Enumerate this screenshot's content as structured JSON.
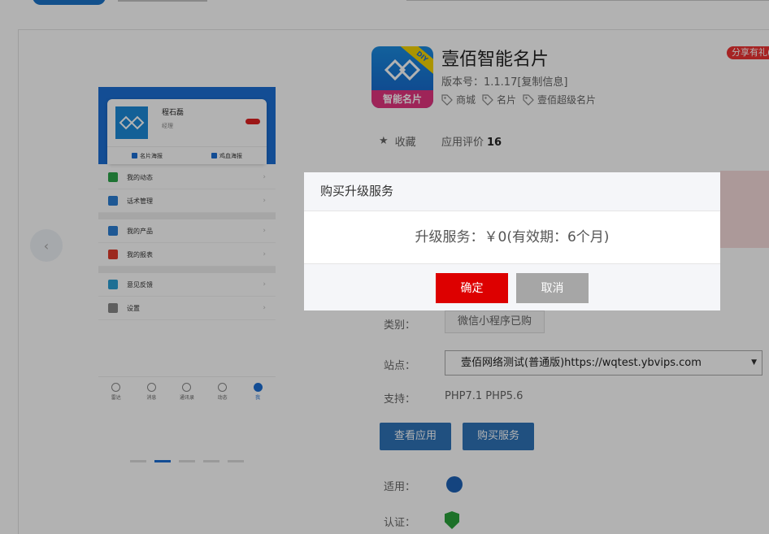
{
  "phone_preview": {
    "profile_name": "程石磊",
    "profile_role": "经理",
    "actions": [
      "名片海报",
      "鸡血海报"
    ],
    "menu_groups": [
      [
        {
          "label": "我的动态",
          "color": "#2ca54a"
        },
        {
          "label": "话术管理",
          "color": "#2c7fd4"
        }
      ],
      [
        {
          "label": "我的产品",
          "color": "#2c7fd4"
        },
        {
          "label": "我的报表",
          "color": "#e03b2c"
        }
      ],
      [
        {
          "label": "意见反馈",
          "color": "#2c9fd4"
        },
        {
          "label": "设置",
          "color": "#888888"
        }
      ]
    ],
    "tabs": [
      "雷达",
      "消息",
      "通讯录",
      "动态",
      "我"
    ]
  },
  "app": {
    "icon_label": "智能名片",
    "icon_diy": "DIY",
    "title": "壹佰智能名片",
    "version": "版本号：1.1.17[复制信息]",
    "tags": [
      "商城",
      "名片",
      "壹佰超级名片"
    ],
    "share_badge": "分享有礼(",
    "favorite": "收藏",
    "rating_label": "应用评价",
    "rating_count": "16"
  },
  "details": {
    "category_label": "类别：",
    "category_value": "微信小程序已购",
    "site_label": "站点：",
    "site_value": "壹佰网络测试(普通版)https://wqtest.ybvips.com",
    "support_label": "支持：",
    "support_value": "PHP7.1  PHP5.6",
    "view_button": "查看应用",
    "buy_button": "购买服务",
    "apply_label": "适用：",
    "cert_label": "认证："
  },
  "modal": {
    "title": "购买升级服务",
    "message": "升级服务：￥0(有效期：6个月)",
    "ok": "确定",
    "cancel": "取消"
  }
}
